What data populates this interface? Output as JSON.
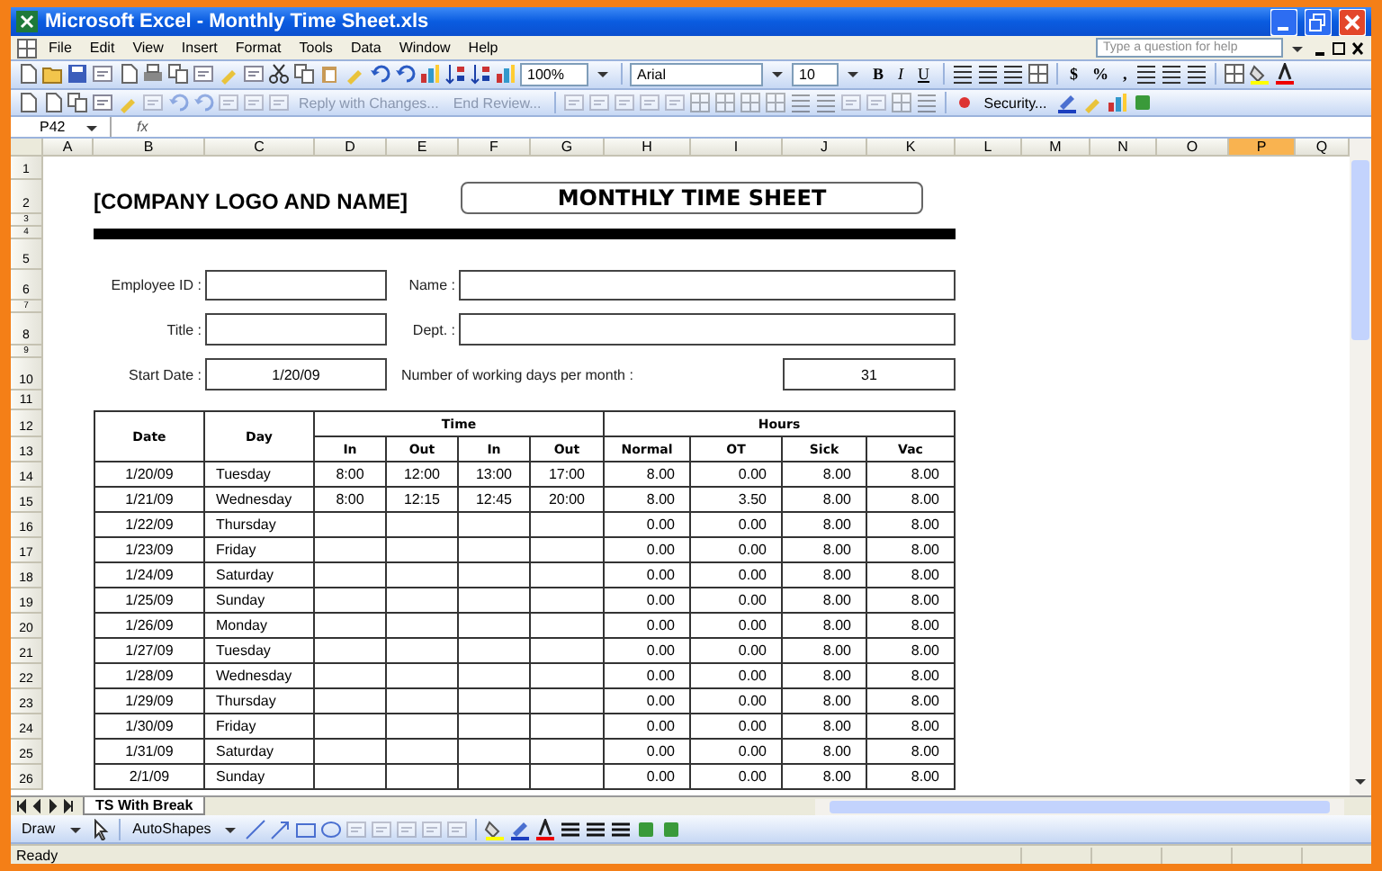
{
  "window": {
    "title": "Microsoft Excel - Monthly Time Sheet.xls"
  },
  "menu": [
    {
      "label": "File"
    },
    {
      "label": "Edit"
    },
    {
      "label": "View"
    },
    {
      "label": "Insert"
    },
    {
      "label": "Format"
    },
    {
      "label": "Tools"
    },
    {
      "label": "Data"
    },
    {
      "label": "Window"
    },
    {
      "label": "Help"
    }
  ],
  "help_box": {
    "placeholder": "Type a question for help"
  },
  "standard_toolbar": {
    "zoom": "100%"
  },
  "formatting_toolbar": {
    "font": "Arial",
    "size": "10",
    "style_buttons": [
      "B",
      "I",
      "U"
    ],
    "number_buttons": [
      "$",
      "%",
      ","
    ]
  },
  "reviewing_toolbar": {
    "reply": "Reply with Changes...",
    "end_review": "End Review...",
    "security": "Security..."
  },
  "formula_bar": {
    "name_box": "P42",
    "fx": "fx"
  },
  "columns": [
    {
      "label": "A",
      "selected": false
    },
    {
      "label": "B",
      "selected": false
    },
    {
      "label": "C",
      "selected": false
    },
    {
      "label": "D",
      "selected": false
    },
    {
      "label": "E",
      "selected": false
    },
    {
      "label": "F",
      "selected": false
    },
    {
      "label": "G",
      "selected": false
    },
    {
      "label": "H",
      "selected": false
    },
    {
      "label": "I",
      "selected": false
    },
    {
      "label": "J",
      "selected": false
    },
    {
      "label": "K",
      "selected": false
    },
    {
      "label": "L",
      "selected": false
    },
    {
      "label": "M",
      "selected": false
    },
    {
      "label": "N",
      "selected": false
    },
    {
      "label": "O",
      "selected": false
    },
    {
      "label": "P",
      "selected": true
    },
    {
      "label": "Q",
      "selected": false
    }
  ],
  "row_numbers": [
    "1",
    "2",
    "3",
    "4",
    "5",
    "6",
    "7",
    "8",
    "9",
    "10",
    "11",
    "12",
    "13",
    "14",
    "15",
    "16",
    "17",
    "18",
    "19",
    "20",
    "21",
    "22",
    "23",
    "24",
    "25",
    "26"
  ],
  "sheet": {
    "company": "[COMPANY LOGO AND NAME]",
    "title": "MONTHLY TIME SHEET",
    "employee_id": {
      "label": "Employee ID :"
    },
    "name": {
      "label": "Name :"
    },
    "job_title": {
      "label": "Title :"
    },
    "dept": {
      "label": "Dept. :"
    },
    "start_date": {
      "label": "Start Date :",
      "value": "1/20/09"
    },
    "working_days": {
      "label": "Number of working days per month :",
      "value": "31"
    },
    "table": {
      "date_header": "Date",
      "day_header": "Day",
      "time_header": "Time",
      "hours_header": "Hours",
      "time_columns": [
        "In",
        "Out",
        "In",
        "Out"
      ],
      "hours_columns": [
        "Normal",
        "OT",
        "Sick",
        "Vac"
      ],
      "rows": [
        {
          "date": "1/20/09",
          "day": "Tuesday",
          "times": [
            "8:00",
            "12:00",
            "13:00",
            "17:00"
          ],
          "hours": [
            "8.00",
            "0.00",
            "8.00",
            "8.00"
          ]
        },
        {
          "date": "1/21/09",
          "day": "Wednesday",
          "times": [
            "8:00",
            "12:15",
            "12:45",
            "20:00"
          ],
          "hours": [
            "8.00",
            "3.50",
            "8.00",
            "8.00"
          ]
        },
        {
          "date": "1/22/09",
          "day": "Thursday",
          "hours": [
            "0.00",
            "0.00",
            "8.00",
            "8.00"
          ]
        },
        {
          "date": "1/23/09",
          "day": "Friday",
          "hours": [
            "0.00",
            "0.00",
            "8.00",
            "8.00"
          ]
        },
        {
          "date": "1/24/09",
          "day": "Saturday",
          "hours": [
            "0.00",
            "0.00",
            "8.00",
            "8.00"
          ]
        },
        {
          "date": "1/25/09",
          "day": "Sunday",
          "hours": [
            "0.00",
            "0.00",
            "8.00",
            "8.00"
          ]
        },
        {
          "date": "1/26/09",
          "day": "Monday",
          "hours": [
            "0.00",
            "0.00",
            "8.00",
            "8.00"
          ]
        },
        {
          "date": "1/27/09",
          "day": "Tuesday",
          "hours": [
            "0.00",
            "0.00",
            "8.00",
            "8.00"
          ]
        },
        {
          "date": "1/28/09",
          "day": "Wednesday",
          "hours": [
            "0.00",
            "0.00",
            "8.00",
            "8.00"
          ]
        },
        {
          "date": "1/29/09",
          "day": "Thursday",
          "hours": [
            "0.00",
            "0.00",
            "8.00",
            "8.00"
          ]
        },
        {
          "date": "1/30/09",
          "day": "Friday",
          "hours": [
            "0.00",
            "0.00",
            "8.00",
            "8.00"
          ]
        },
        {
          "date": "1/31/09",
          "day": "Saturday",
          "hours": [
            "0.00",
            "0.00",
            "8.00",
            "8.00"
          ]
        },
        {
          "date": "2/1/09",
          "day": "Sunday",
          "hours": [
            "0.00",
            "0.00",
            "8.00",
            "8.00"
          ]
        }
      ]
    }
  },
  "sheet_tabs": [
    {
      "label": "TS With Break",
      "selected": true
    }
  ],
  "drawing_toolbar": {
    "draw": "Draw",
    "autoshapes": "AutoShapes"
  },
  "status_bar": {
    "text": "Ready"
  }
}
